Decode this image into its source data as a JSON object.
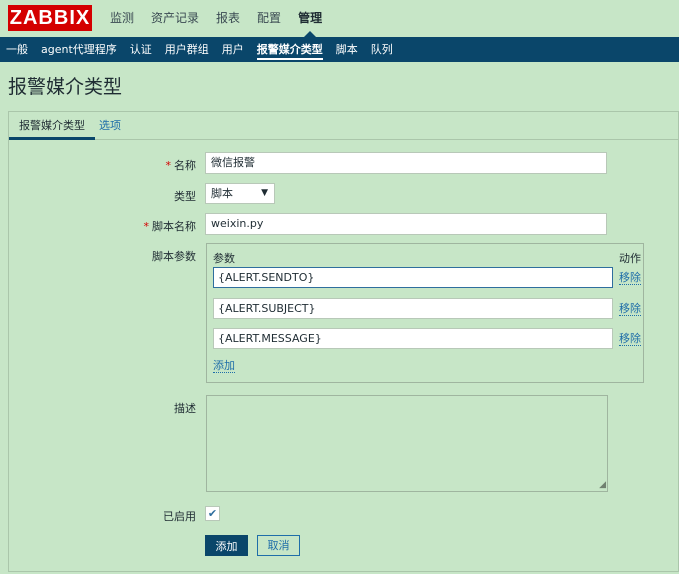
{
  "brand": {
    "logo_text": "ZABBIX",
    "color": "#d40000"
  },
  "main_nav": [
    "监测",
    "资产记录",
    "报表",
    "配置",
    "管理"
  ],
  "main_nav_active": "管理",
  "sub_nav": [
    "一般",
    "agent代理程序",
    "认证",
    "用户群组",
    "用户",
    "报警媒介类型",
    "脚本",
    "队列"
  ],
  "sub_nav_active": "报警媒介类型",
  "page_title": "报警媒介类型",
  "tabs": {
    "active": "报警媒介类型",
    "other": "选项"
  },
  "form": {
    "name_label": "名称",
    "name_value": "微信报警",
    "type_label": "类型",
    "type_value": "脚本",
    "script_name_label": "脚本名称",
    "script_name_value": "weixin.py",
    "script_params_label": "脚本参数",
    "params_header": "参数",
    "action_header": "动作",
    "params": [
      {
        "value": "{ALERT.SENDTO}",
        "action": "移除"
      },
      {
        "value": "{ALERT.SUBJECT}",
        "action": "移除"
      },
      {
        "value": "{ALERT.MESSAGE}",
        "action": "移除"
      }
    ],
    "add_param": "添加",
    "description_label": "描述",
    "description_value": "",
    "enabled_label": "已启用",
    "enabled": true,
    "add_button": "添加",
    "cancel_button": "取消"
  },
  "colors": {
    "accent": "#0a466a",
    "link": "#1f6ea9",
    "background": "#c7e6c7",
    "required": "#d40000"
  }
}
